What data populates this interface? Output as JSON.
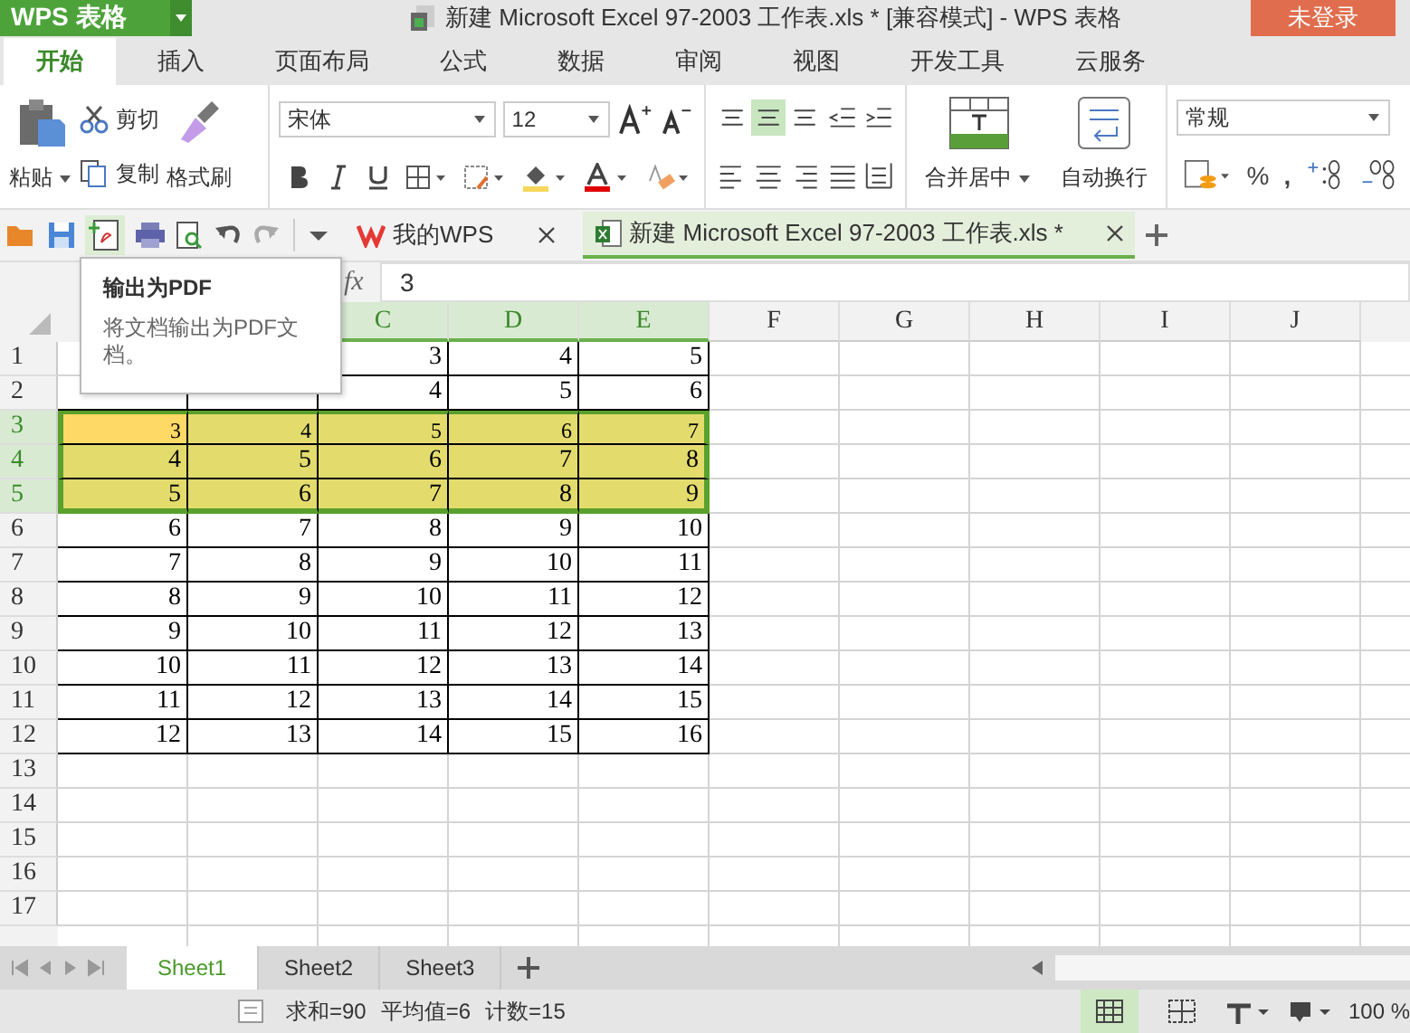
{
  "app": {
    "logo": "WPS 表格"
  },
  "window": {
    "title": "新建 Microsoft Excel 97-2003 工作表.xls * [兼容模式] - WPS 表格"
  },
  "login_button": "未登录",
  "tabs": [
    {
      "label": "开始",
      "selected": true
    },
    {
      "label": "插入",
      "selected": false
    },
    {
      "label": "页面布局",
      "selected": false
    },
    {
      "label": "公式",
      "selected": false
    },
    {
      "label": "数据",
      "selected": false
    },
    {
      "label": "审阅",
      "selected": false
    },
    {
      "label": "视图",
      "selected": false
    },
    {
      "label": "开发工具",
      "selected": false
    },
    {
      "label": "云服务",
      "selected": false
    }
  ],
  "ribbon": {
    "paste": "粘贴",
    "cut": "剪切",
    "copy": "复制",
    "format_painter": "格式刷",
    "font_name": "宋体",
    "font_size": "12",
    "align_buttons": [
      {
        "selected": false
      },
      {
        "selected": true
      },
      {
        "selected": false
      }
    ],
    "merge": "合并居中",
    "wrap": "自动换行",
    "number_format": "常规",
    "percent": "%",
    "comma": ","
  },
  "doc_tabs": [
    {
      "kind": "home",
      "label": "我的WPS",
      "selected": false
    },
    {
      "kind": "sheet",
      "label": "新建 Microsoft Excel 97-2003 工作表.xls *",
      "selected": true
    }
  ],
  "tooltip": {
    "title": "输出为PDF",
    "text": "将文档输出为PDF文档。"
  },
  "formula_bar": {
    "fx": "fx",
    "value": "3"
  },
  "columns": [
    {
      "label": "C",
      "selected": true
    },
    {
      "label": "D",
      "selected": true
    },
    {
      "label": "E",
      "selected": true
    },
    {
      "label": "F",
      "selected": false
    },
    {
      "label": "G",
      "selected": false
    },
    {
      "label": "H",
      "selected": false
    },
    {
      "label": "I",
      "selected": false
    },
    {
      "label": "J",
      "selected": false
    }
  ],
  "rows": [
    {
      "label": "1",
      "selected": false,
      "cells": [
        null,
        null,
        {
          "text": "3",
          "active": false
        },
        {
          "text": "4",
          "active": false
        },
        {
          "text": "5",
          "active": false
        }
      ]
    },
    {
      "label": "2",
      "selected": false,
      "cells": [
        {
          "active": false
        },
        {
          "active": false
        },
        {
          "text": "4",
          "active": false
        },
        {
          "text": "5",
          "active": false
        },
        {
          "text": "6",
          "active": false
        }
      ]
    },
    {
      "label": "3",
      "selected": true,
      "cells": [
        {
          "text": "3",
          "active": true
        },
        {
          "text": "4",
          "active": false
        },
        {
          "text": "5",
          "active": false
        },
        {
          "text": "6",
          "active": false
        },
        {
          "text": "7",
          "active": false
        }
      ]
    },
    {
      "label": "4",
      "selected": true,
      "cells": [
        {
          "text": "4",
          "active": false
        },
        {
          "text": "5",
          "active": false
        },
        {
          "text": "6",
          "active": false
        },
        {
          "text": "7",
          "active": false
        },
        {
          "text": "8",
          "active": false
        }
      ]
    },
    {
      "label": "5",
      "selected": true,
      "cells": [
        {
          "text": "5",
          "active": false
        },
        {
          "text": "6",
          "active": false
        },
        {
          "text": "7",
          "active": false
        },
        {
          "text": "8",
          "active": false
        },
        {
          "text": "9",
          "active": false
        }
      ]
    },
    {
      "label": "6",
      "selected": false,
      "cells": [
        {
          "text": "6",
          "active": false
        },
        {
          "text": "7",
          "active": false
        },
        {
          "text": "8",
          "active": false
        },
        {
          "text": "9",
          "active": false
        },
        {
          "text": "10",
          "active": false
        }
      ]
    },
    {
      "label": "7",
      "selected": false,
      "cells": [
        {
          "text": "7",
          "active": false
        },
        {
          "text": "8",
          "active": false
        },
        {
          "text": "9",
          "active": false
        },
        {
          "text": "10",
          "active": false
        },
        {
          "text": "11",
          "active": false
        }
      ]
    },
    {
      "label": "8",
      "selected": false,
      "cells": [
        {
          "text": "8",
          "active": false
        },
        {
          "text": "9",
          "active": false
        },
        {
          "text": "10",
          "active": false
        },
        {
          "text": "11",
          "active": false
        },
        {
          "text": "12",
          "active": false
        }
      ]
    },
    {
      "label": "9",
      "selected": false,
      "cells": [
        {
          "text": "9",
          "active": false
        },
        {
          "text": "10",
          "active": false
        },
        {
          "text": "11",
          "active": false
        },
        {
          "text": "12",
          "active": false
        },
        {
          "text": "13",
          "active": false
        }
      ]
    },
    {
      "label": "10",
      "selected": false,
      "cells": [
        {
          "text": "10",
          "active": false
        },
        {
          "text": "11",
          "active": false
        },
        {
          "text": "12",
          "active": false
        },
        {
          "text": "13",
          "active": false
        },
        {
          "text": "14",
          "active": false
        }
      ]
    },
    {
      "label": "11",
      "selected": false,
      "cells": [
        {
          "text": "11",
          "active": false
        },
        {
          "text": "12",
          "active": false
        },
        {
          "text": "13",
          "active": false
        },
        {
          "text": "14",
          "active": false
        },
        {
          "text": "15",
          "active": false
        }
      ]
    },
    {
      "label": "12",
      "selected": false,
      "cells": [
        {
          "text": "12",
          "active": false
        },
        {
          "text": "13",
          "active": false
        },
        {
          "text": "14",
          "active": false
        },
        {
          "text": "15",
          "active": false
        },
        {
          "text": "16",
          "active": false
        }
      ]
    },
    {
      "label": "13",
      "selected": false
    },
    {
      "label": "14",
      "selected": false
    },
    {
      "label": "15",
      "selected": false
    },
    {
      "label": "16",
      "selected": false
    },
    {
      "label": "17",
      "selected": false
    }
  ],
  "sheet_tabs": [
    {
      "label": "Sheet1",
      "selected": true
    },
    {
      "label": "Sheet2",
      "selected": false
    },
    {
      "label": "Sheet3",
      "selected": false
    }
  ],
  "status": {
    "sum": "求和=90",
    "average": "平均值=6",
    "count": "计数=15",
    "zoom": "100 %"
  }
}
